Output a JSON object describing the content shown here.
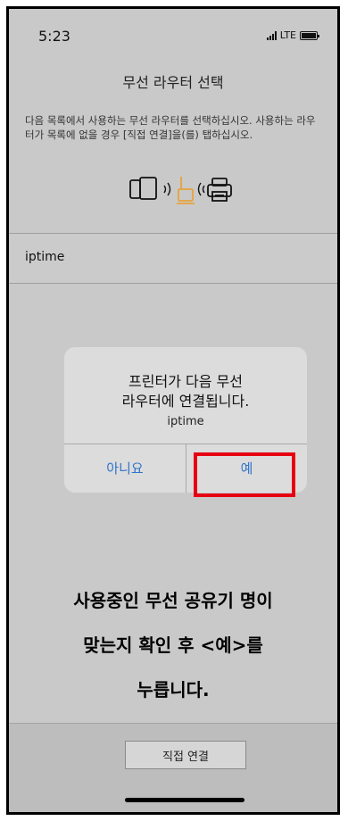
{
  "status_bar": {
    "time": "5:23",
    "network": "LTE"
  },
  "header": {
    "title": "무선 라우터 선택"
  },
  "description": "다음 목록에서 사용하는 무선 라우터를 선택하십시오. 사용하는 라우터가 목록에 없을 경우 [직접 연결]을(를) 탭하십시오.",
  "illustration": {
    "icons": [
      "smartphone-icon",
      "wifi-waves-icon",
      "router-icon",
      "wifi-waves-icon",
      "printer-icon"
    ],
    "router_color": "#e6a23c"
  },
  "router_list": [
    {
      "name": "iptime"
    }
  ],
  "dialog": {
    "title_line1": "프린터가 다음 무선",
    "title_line2": "라우터에 연결됩니다.",
    "router_name": "iptime",
    "no_label": "아니요",
    "yes_label": "예",
    "button_color": "#2f74c9",
    "highlight_color": "#e60012"
  },
  "instruction": {
    "line1": "사용중인 무선 공유기 명이",
    "line2": "맞는지 확인 후 <예>를",
    "line3": "누릅니다."
  },
  "footer": {
    "direct_connect_label": "직접 연결"
  }
}
